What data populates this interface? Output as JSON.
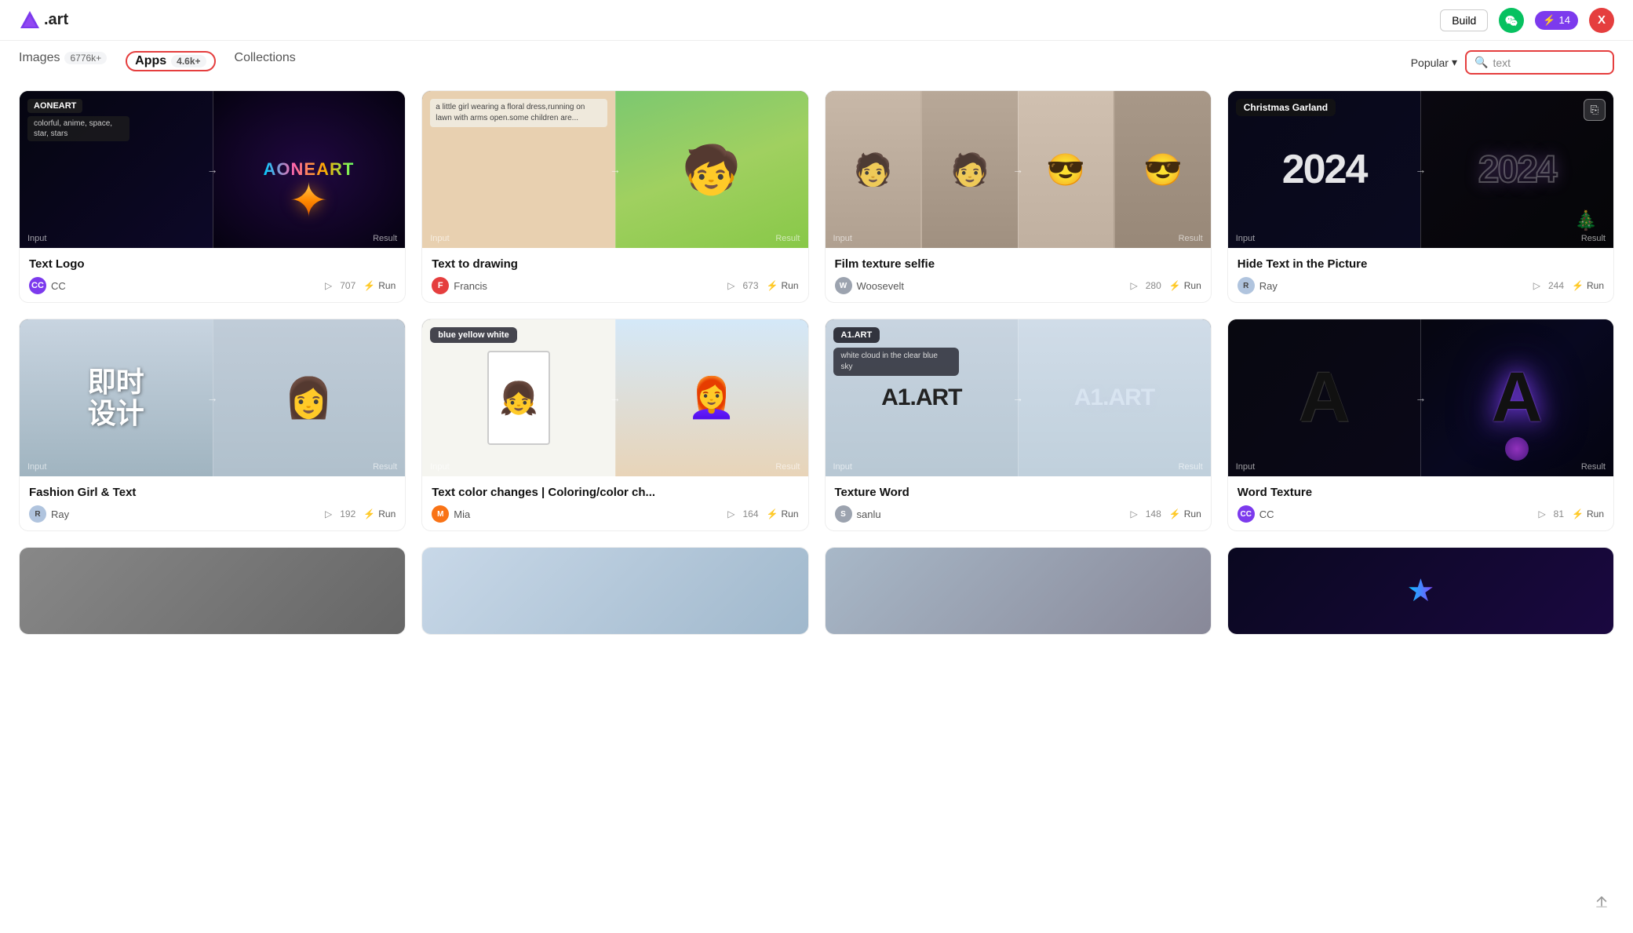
{
  "app": {
    "title": ".art",
    "logo_symbol": "▲"
  },
  "header": {
    "build_label": "Build",
    "lightning_count": "14",
    "user_initial": "X"
  },
  "tabs": {
    "images_label": "Images",
    "images_badge": "6776k+",
    "apps_label": "Apps",
    "apps_badge": "4.6k+",
    "collections_label": "Collections"
  },
  "sort": {
    "label": "Popular",
    "chevron": "▾"
  },
  "search": {
    "placeholder": "text",
    "value": "text"
  },
  "cards": [
    {
      "id": "text-logo",
      "title": "Text Logo",
      "author": "CC",
      "author_avatar": "CC",
      "author_avatar_class": "av-cc",
      "plays": "707",
      "run_label": "Run",
      "overlay_tag": "AONEART",
      "overlay_desc": "colorful, anime, space, star, stars"
    },
    {
      "id": "text-to-drawing",
      "title": "Text to drawing",
      "author": "Francis",
      "author_avatar": "F",
      "author_avatar_class": "av-francis",
      "plays": "673",
      "run_label": "Run",
      "overlay_desc": "a little girl wearing a floral dress,running on lawn with arms open,some children are..."
    },
    {
      "id": "film-texture-selfie",
      "title": "Film texture selfie",
      "author": "Woosevelt",
      "author_avatar": "W",
      "author_avatar_class": "av-woosevelt",
      "plays": "280",
      "run_label": "Run"
    },
    {
      "id": "hide-text",
      "title": "Hide Text in the Picture",
      "author": "Ray",
      "author_avatar": "R",
      "author_avatar_class": "av-ray",
      "plays": "244",
      "run_label": "Run",
      "overlay_tag": "Christmas Garland"
    },
    {
      "id": "fashion-girl-text",
      "title": "Fashion Girl & Text",
      "author": "Ray",
      "author_avatar": "R",
      "author_avatar_class": "av-ray",
      "plays": "192",
      "run_label": "Run"
    },
    {
      "id": "text-color-changes",
      "title": "Text color changes | Coloring/color ch...",
      "author": "Mia",
      "author_avatar": "M",
      "author_avatar_class": "av-mia",
      "plays": "164",
      "run_label": "Run",
      "overlay_tag": "blue yellow white"
    },
    {
      "id": "texture-word",
      "title": "Texture Word",
      "author": "sanlu",
      "author_avatar": "S",
      "author_avatar_class": "av-sanlu",
      "plays": "148",
      "run_label": "Run",
      "overlay_tag": "A1.ART",
      "overlay_desc": "white cloud in the clear blue sky"
    },
    {
      "id": "word-texture",
      "title": "Word Texture",
      "author": "CC",
      "author_avatar": "CC",
      "author_avatar_class": "av-cc",
      "plays": "81",
      "run_label": "Run"
    }
  ],
  "labels": {
    "input": "Input",
    "result": "Result",
    "arrow": "→",
    "run_icon": "⚡",
    "play_icon": "▷",
    "search_icon": "🔍"
  }
}
